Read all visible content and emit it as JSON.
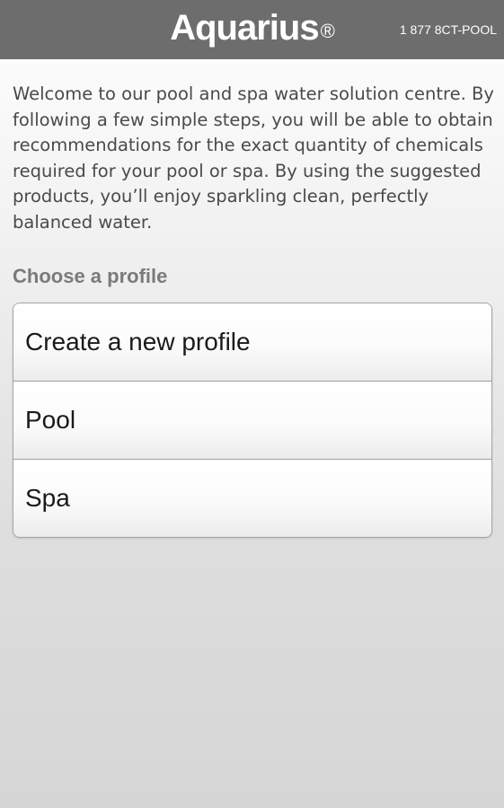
{
  "header": {
    "logo_text": "Aquarius",
    "logo_reg": "®",
    "phone": "1 877 8CT-POOL"
  },
  "intro": {
    "text": "Welcome to our pool and spa water solution centre. By following a few simple steps, you will be able to obtain recommendations for the exact quantity of chemicals required for your pool or spa. By using the suggested products, you’ll enjoy sparkling clean, perfectly balanced water."
  },
  "profiles": {
    "section_label": "Choose a profile",
    "items": [
      {
        "label": "Create a new profile"
      },
      {
        "label": "Pool"
      },
      {
        "label": "Spa"
      }
    ]
  },
  "colors": {
    "header_bg": "#6d6d6d",
    "text": "#4a4a4a",
    "section_label": "#7a7a7a"
  }
}
